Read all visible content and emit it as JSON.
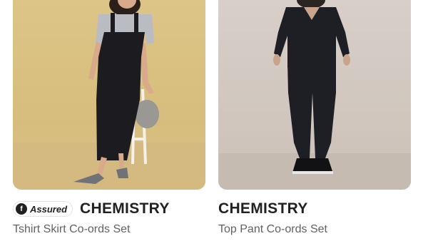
{
  "products": [
    {
      "assured_badge": "Assured",
      "brand": "CHEMISTRY",
      "title": "Tshirt Skirt Co-ords Set",
      "image_alt": "Woman in black pinafore skirt with grey t-shirt"
    },
    {
      "brand": "CHEMISTRY",
      "title": "Top Pant Co-ords Set",
      "image_alt": "Woman in black top and black cargo pants"
    }
  ]
}
